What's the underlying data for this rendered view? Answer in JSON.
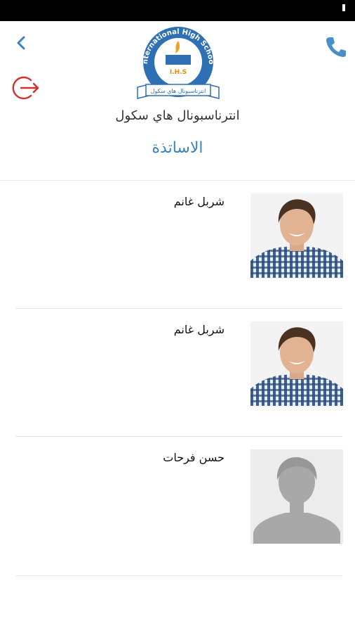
{
  "header": {
    "school_name": "انترناسبونال هاي سكول",
    "page_title": "الاساتذة",
    "logo": {
      "arc_text": "International High School",
      "initials": "I.H.S",
      "banner_text": "انترناسبونال هاي سكول"
    }
  },
  "teachers": [
    {
      "name": "شربل غانم",
      "photo": "teacher-photo"
    },
    {
      "name": "شربل غانم",
      "photo": "teacher-photo"
    },
    {
      "name": "حسن فرحات",
      "photo": "placeholder-avatar"
    }
  ],
  "colors": {
    "accent": "#3d82bd",
    "logout": "#d0312d",
    "logo_blue": "#2f6fb3",
    "logo_gold": "#f0a020"
  },
  "icons": {
    "back": "chevron-left-icon",
    "phone": "phone-icon",
    "logout": "logout-icon"
  }
}
